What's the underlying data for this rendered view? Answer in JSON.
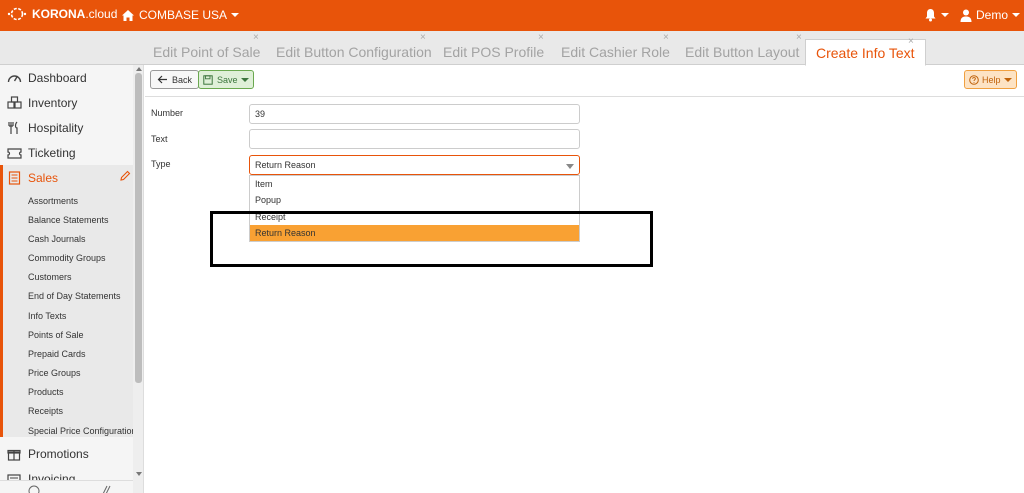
{
  "header": {
    "brand_bold": "KORONA",
    "brand_light": ".cloud",
    "company": "COMBASE USA",
    "user": "Demo",
    "icons": [
      "korona-logo-icon",
      "home-icon",
      "bell-icon",
      "user-icon"
    ]
  },
  "tabs": [
    {
      "label": "Edit Point of Sale",
      "active": false
    },
    {
      "label": "Edit Button Configuration",
      "active": false
    },
    {
      "label": "Edit POS Profile",
      "active": false
    },
    {
      "label": "Edit Cashier Role",
      "active": false
    },
    {
      "label": "Edit Button Layout",
      "active": false
    },
    {
      "label": "Create Info Text",
      "active": true
    }
  ],
  "tab_close": "×",
  "sidebar": {
    "main": [
      {
        "label": "Dashboard",
        "icon": "dashboard-icon"
      },
      {
        "label": "Inventory",
        "icon": "boxes-icon"
      },
      {
        "label": "Hospitality",
        "icon": "utensils-icon"
      },
      {
        "label": "Ticketing",
        "icon": "ticket-icon"
      },
      {
        "label": "Sales",
        "icon": "receipt-list-icon",
        "active": true
      },
      {
        "label": "Promotions",
        "icon": "gift-icon"
      },
      {
        "label": "Invoicing",
        "icon": "invoice-icon"
      }
    ],
    "sales_sub": [
      "Assortments",
      "Balance Statements",
      "Cash Journals",
      "Commodity Groups",
      "Customers",
      "End of Day Statements",
      "Info Texts",
      "Points of Sale",
      "Prepaid Cards",
      "Price Groups",
      "Products",
      "Receipts",
      "Special Price Configurations"
    ]
  },
  "toolbar": {
    "back_label": "Back",
    "save_label": "Save",
    "help_label": "Help"
  },
  "form": {
    "number_label": "Number",
    "number_value": "39",
    "text_label": "Text",
    "text_value": "",
    "type_label": "Type",
    "type_value": "Return Reason",
    "type_options": [
      "Item",
      "Popup",
      "Receipt",
      "Return Reason"
    ],
    "type_selected_index": 3
  },
  "colors": {
    "accent": "#e8540a",
    "highlight": "#f9a133",
    "save_green": "#dff0d8",
    "help_orange": "#fde3c4"
  }
}
